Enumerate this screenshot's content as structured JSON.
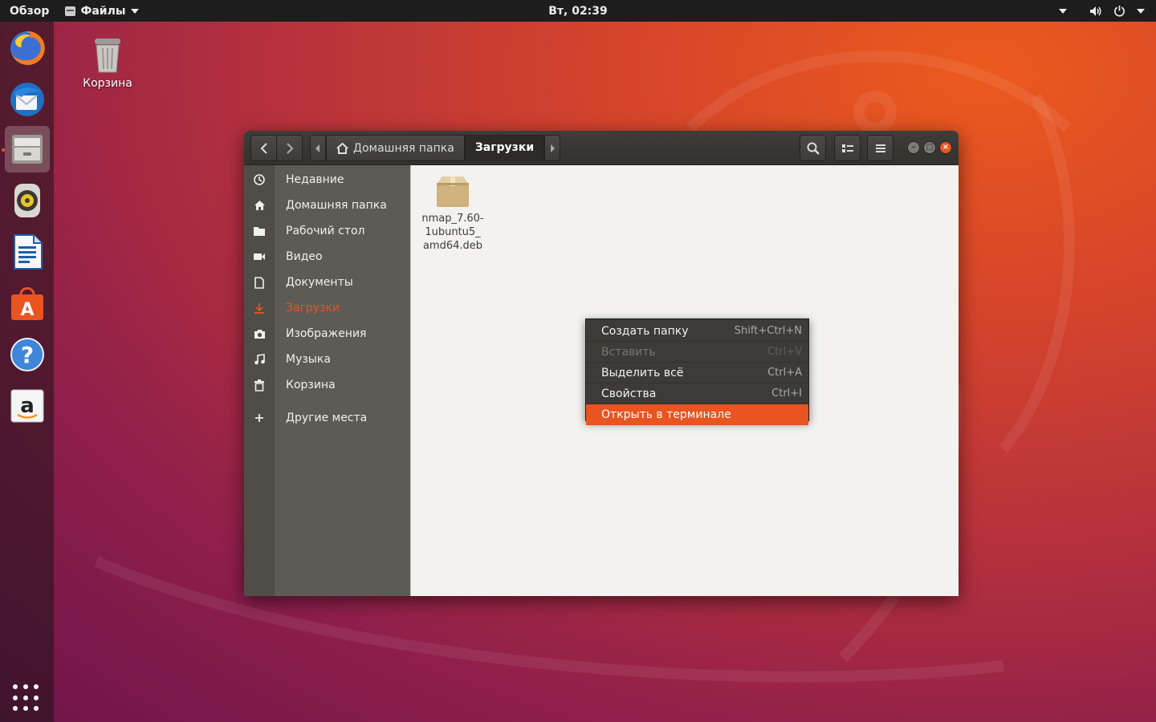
{
  "topbar": {
    "activities": "Обзор",
    "app_menu": "Файлы",
    "clock": "Вт, 02:39"
  },
  "dock": {
    "items": [
      "firefox-icon",
      "thunderbird-icon",
      "files-icon",
      "rhythmbox-icon",
      "libreoffice-writer-icon",
      "ubuntu-software-icon",
      "help-icon",
      "amazon-icon"
    ],
    "active_index": 2
  },
  "desktop": {
    "trash_label": "Корзина"
  },
  "window": {
    "path": [
      "Домашняя папка",
      "Загрузки"
    ],
    "sidebar": [
      {
        "label": "Недавние",
        "icon": "clock-icon"
      },
      {
        "label": "Домашняя папка",
        "icon": "home-icon"
      },
      {
        "label": "Рабочий стол",
        "icon": "folder-icon"
      },
      {
        "label": "Видео",
        "icon": "video-icon"
      },
      {
        "label": "Документы",
        "icon": "document-icon"
      },
      {
        "label": "Загрузки",
        "icon": "download-icon",
        "active": true
      },
      {
        "label": "Изображения",
        "icon": "camera-icon"
      },
      {
        "label": "Музыка",
        "icon": "music-icon"
      },
      {
        "label": "Корзина",
        "icon": "trash-icon"
      },
      {
        "label": "Другие места",
        "icon": "plus-icon"
      }
    ],
    "files": [
      {
        "name_lines": [
          "nmap_7.60-",
          "1ubuntu5_",
          "amd64.deb"
        ],
        "icon": "package-icon"
      }
    ]
  },
  "context_menu": {
    "items": [
      {
        "label": "Создать папку",
        "accel": "Shift+Ctrl+N"
      },
      {
        "label": "Вставить",
        "accel": "Ctrl+V",
        "disabled": true
      },
      {
        "label": "Выделить всё",
        "accel": "Ctrl+A"
      },
      {
        "label": "Свойства",
        "accel": "Ctrl+I"
      },
      {
        "label": "Открыть в терминале",
        "accel": "",
        "highlighted": true
      }
    ]
  },
  "colors": {
    "accent": "#e95420",
    "topbar": "#1d1d1d",
    "sidebar": "#5d5b55",
    "menu_bg": "#3c3b37"
  }
}
